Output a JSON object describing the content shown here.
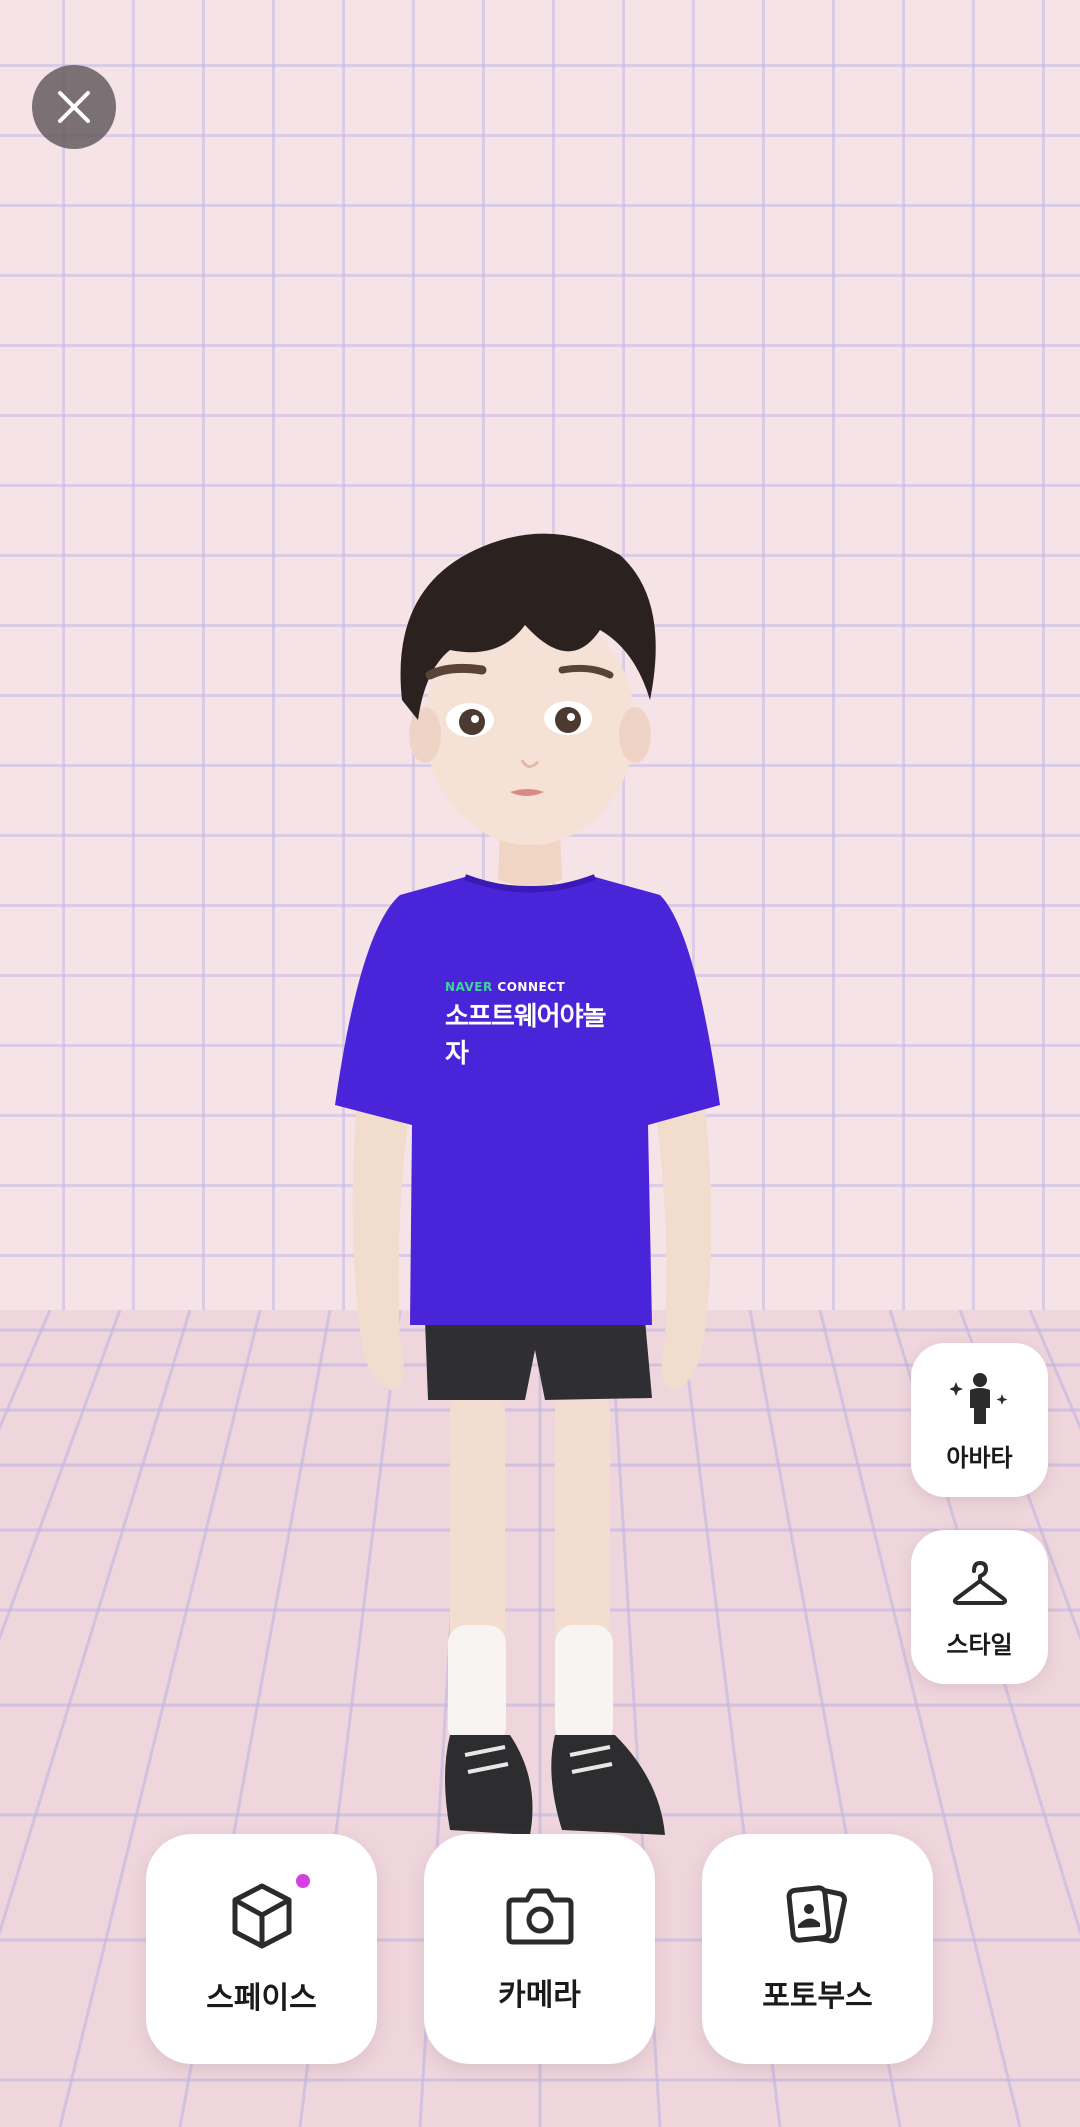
{
  "close_button": {
    "icon": "close-icon"
  },
  "side_menu": {
    "avatar": {
      "label": "아바타",
      "icon": "avatar-icon"
    },
    "style": {
      "label": "스타일",
      "icon": "hanger-icon"
    }
  },
  "bottom_menu": {
    "space": {
      "label": "스페이스",
      "icon": "cube-icon",
      "has_new_badge": true
    },
    "camera": {
      "label": "카메라",
      "icon": "camera-icon"
    },
    "photobooth": {
      "label": "포토부스",
      "icon": "photo-cards-icon"
    }
  },
  "avatar": {
    "shirt_brand_green": "NAVER",
    "shirt_brand_white": " CONNECT",
    "shirt_slogan": "소프트웨어야놀자"
  },
  "colors": {
    "background": "#f6e3e7",
    "grid": "#c3b9e1",
    "shirt": "#4a24d8",
    "badge": "#d63fe0"
  }
}
